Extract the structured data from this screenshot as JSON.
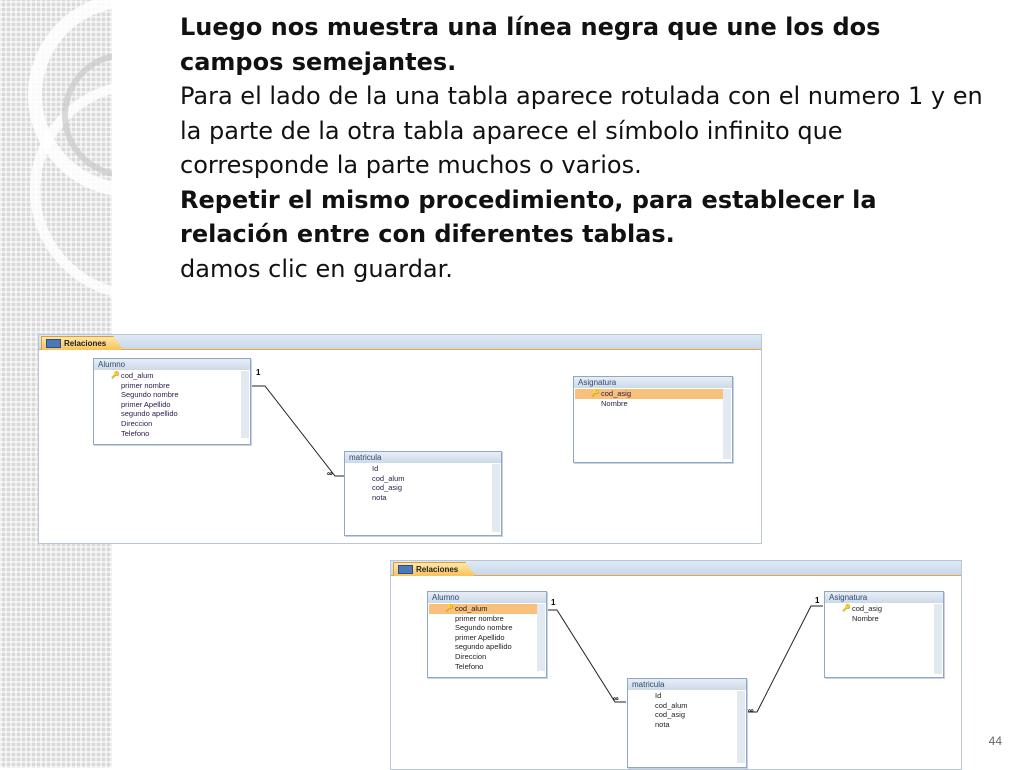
{
  "slide": {
    "paragraphs": [
      {
        "text": "Luego nos muestra una línea negra que une los dos campos semejantes.",
        "bold": true
      },
      {
        "text": "Para el lado de la una tabla aparece rotulada con el numero 1 y en la parte de la otra tabla aparece el símbolo infinito que corresponde la parte muchos o varios.",
        "bold": false
      },
      {
        "text": "Repetir el mismo procedimiento, para establecer la relación entre con diferentes tablas.",
        "bold": true
      },
      {
        "text": "damos clic en guardar.",
        "bold": false
      }
    ],
    "page_number": "44"
  },
  "window1": {
    "tab_label": "Relaciones",
    "tables": {
      "alumno": {
        "title": "Alumno",
        "fields": [
          "cod_alum",
          "primer nombre",
          "Segundo nombre",
          "primer Apellido",
          "segundo apellido",
          "Direccion",
          "Telefono"
        ]
      },
      "matricula": {
        "title": "matricula",
        "fields": [
          "Id",
          "cod_alum",
          "cod_asig",
          "nota"
        ]
      },
      "asignatura": {
        "title": "Asignatura",
        "fields": [
          "cod_asig",
          "Nombre"
        ]
      }
    },
    "rel_one": "1",
    "rel_many": "∞"
  },
  "window2": {
    "tab_label": "Relaciones",
    "tables": {
      "alumno": {
        "title": "Alumno",
        "fields": [
          "cod_alum",
          "primer nombre",
          "Segundo nombre",
          "primer Apellido",
          "segundo apellido",
          "Direccion",
          "Telefono"
        ]
      },
      "matricula": {
        "title": "matricula",
        "fields": [
          "Id",
          "cod_alum",
          "cod_asig",
          "nota"
        ]
      },
      "asignatura": {
        "title": "Asignatura",
        "fields": [
          "cod_asig",
          "Nombre"
        ]
      }
    },
    "rel1_one": "1",
    "rel1_many": "∞",
    "rel2_one": "1",
    "rel2_many": "∞"
  },
  "icons": {
    "primary_key": "key-icon",
    "tab": "relationships-tab-icon"
  }
}
